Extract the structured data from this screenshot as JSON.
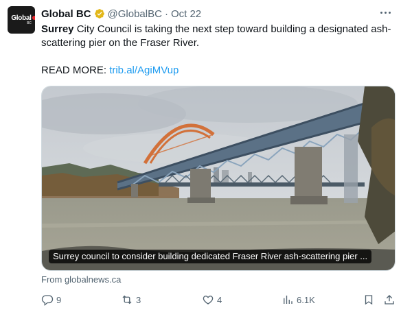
{
  "account": {
    "name": "Global BC",
    "handle": "@GlobalBC",
    "separator": "·",
    "date": "Oct 22",
    "avatar_text": "Global",
    "avatar_sub": "BC"
  },
  "tweet": {
    "bold_lead": "Surrey",
    "text": " City Council is taking the next step toward building a designated ash-scattering pier on the Fraser River.",
    "read_more_label": "READ MORE:",
    "link": "trib.al/AgiMVup"
  },
  "media": {
    "caption": "Surrey council to consider building dedicated Fraser River ash-scattering pier ..."
  },
  "source": "From globalnews.ca",
  "metrics": {
    "replies": "9",
    "reposts": "3",
    "likes": "4",
    "views": "6.1K"
  },
  "colors": {
    "accent": "#1d9bf0",
    "verified": "#e2b719",
    "muted": "#536471",
    "brand_red": "#e8262b"
  },
  "icons": [
    "more-icon",
    "verified-icon",
    "reply-icon",
    "repost-icon",
    "like-icon",
    "views-icon",
    "bookmark-icon",
    "share-icon"
  ]
}
